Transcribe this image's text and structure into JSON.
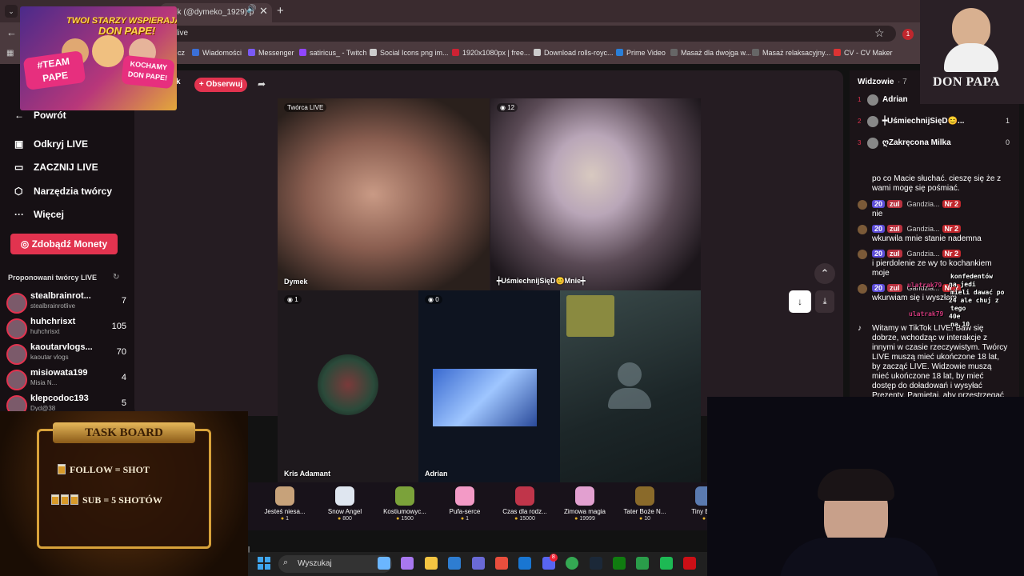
{
  "browser": {
    "tab_title": "ek (@dymeko_1929) p",
    "url": "live",
    "bookmarks": [
      {
        "label": "Wiadomości",
        "color": "#3b6fd6"
      },
      {
        "label": "Messenger",
        "color": "#7a5af5"
      },
      {
        "label": "satiricus_ - Twitch",
        "color": "#9146ff"
      },
      {
        "label": "Social Icons png im...",
        "color": "#cccccc"
      },
      {
        "label": "1920x1080px | free...",
        "color": "#c23"
      },
      {
        "label": "Download rolls-royc...",
        "color": "#cccccc"
      },
      {
        "label": "Prime Video",
        "color": "#2a7fd8"
      },
      {
        "label": "Masaż dla dwojga w...",
        "color": "#666666"
      },
      {
        "label": "Masaż relaksacyjny...",
        "color": "#666666"
      },
      {
        "label": "CV - CV Maker",
        "color": "#d33"
      }
    ],
    "bookmark_prefix": "cz",
    "ext_badge": "1"
  },
  "sidebar": {
    "back": "Powrót",
    "nav": [
      {
        "label": "Odkryj LIVE",
        "icon": "calendar-icon"
      },
      {
        "label": "ZACZNIJ LIVE",
        "icon": "camera-icon"
      },
      {
        "label": "Narzędzia twórcy",
        "icon": "shield-icon"
      },
      {
        "label": "Więcej",
        "icon": "more-icon"
      }
    ],
    "coins_button": "Zdobądź Monety",
    "suggested_title": "Proponowani twórcy LIVE",
    "creators": [
      {
        "name": "stealbrainrot...",
        "sub": "stealbrainrotlive",
        "count": "7"
      },
      {
        "name": "huhchrisxt",
        "sub": "huhchrisxt",
        "count": "105"
      },
      {
        "name": "kaoutarvlogs...",
        "sub": "kaoutar vlogs",
        "count": "70"
      },
      {
        "name": "misiowata199",
        "sub": "Misia N...",
        "count": "4"
      },
      {
        "name": "klepcodoc193",
        "sub": "Dyd@38",
        "count": "5"
      }
    ]
  },
  "stage": {
    "host_short": "k",
    "follow_button": "+ Obserwuj",
    "tiles": [
      {
        "label": "Dymek",
        "count": "Twórca LIVE"
      },
      {
        "label": "┿UśmiechnijSięD😊Mnie┿",
        "count": "12"
      },
      {
        "label": "Kris Adamant",
        "count": "1"
      },
      {
        "label": "Adrian",
        "count": "0"
      },
      {
        "label": "",
        "count": ""
      }
    ]
  },
  "viewers": {
    "title": "Widzowie",
    "count": "· 7",
    "list": [
      {
        "rank": "1",
        "name": "Adrian",
        "score": ""
      },
      {
        "rank": "2",
        "name": "┿UśmiechnijSięD😊...",
        "score": "1"
      },
      {
        "rank": "3",
        "name": "ღZakręcona Milka",
        "score": "0"
      }
    ]
  },
  "chat": {
    "messages": [
      {
        "meta": "",
        "text": "po co Macie słuchać. cieszę się że z wami mogę się pośmiać."
      },
      {
        "meta": {
          "lvl": "20",
          "tag": "zul",
          "name": "Gandzia...",
          "nr": "Nr 2"
        },
        "text": "nie"
      },
      {
        "meta": {
          "lvl": "20",
          "tag": "zul",
          "name": "Gandzia...",
          "nr": "Nr 2"
        },
        "text": "wkurwila mnie stanie nademna"
      },
      {
        "meta": {
          "lvl": "20",
          "tag": "zul",
          "name": "Gandzia...",
          "nr": "Nr 2"
        },
        "text": "i pierdolenie ze wy to kochankiem moje"
      },
      {
        "meta": {
          "lvl": "20",
          "tag": "zul",
          "name": "Gandzia...",
          "nr": "Nr 2"
        },
        "text": "wkurwiam się i wyszłam"
      }
    ],
    "system": "Witamy w TikTok LIVE! Baw się dobrze, wchodząc w interakcje z innymi w czasie rzeczywistym. Twórcy LIVE muszą mieć ukończone 18 lat, by zacząć LIVE. Widzowie muszą mieć ukończone 18 lat, by mieć dostęp do doładowań i wysyłać Prezenty. Pamiętaj, aby przestrzegać naszych",
    "overlay_lines": [
      "konfedentów",
      "na jedi",
      "mieli dawać po",
      "24 ale chuj z",
      "tego",
      "40e",
      "na 10"
    ],
    "overlay_names": [
      "ulatrak79",
      "ulatrak79"
    ]
  },
  "gifts": [
    {
      "name": "Jesteś niesa...",
      "price": "1",
      "color": "#c7a27a"
    },
    {
      "name": "Snow Angel",
      "price": "800",
      "color": "#dfe6f0"
    },
    {
      "name": "Kostiumowyc...",
      "price": "1500",
      "color": "#7ba23a"
    },
    {
      "name": "Pufa-serce",
      "price": "1",
      "color": "#f39ac6"
    },
    {
      "name": "Czas dla rodz...",
      "price": "15000",
      "color": "#c0354a"
    },
    {
      "name": "Zimowa magia",
      "price": "19999",
      "color": "#e2a0d0"
    },
    {
      "name": "Tater Boże N...",
      "price": "10",
      "color": "#8a6a2a"
    },
    {
      "name": "Tiny Bo...",
      "price": "",
      "color": "#5a7ab0"
    }
  ],
  "taskbar": {
    "search": "Wyszukaj",
    "discord_badge": "8",
    "icons": [
      "#6bb6ff",
      "#a878f0",
      "#f4c542",
      "#2e7dd1",
      "#6a6ad6",
      "#e94e3d",
      "#1976d2",
      "#5865f2",
      "#34a853",
      "#1b2838",
      "#107c10",
      "#2a9d4a",
      "#1db954",
      "#cc0f16"
    ]
  },
  "promo": {
    "line1": "TWOI STARZY WSPIERAJĄ",
    "line2": "DON PAPE!",
    "team": "#TEAM PAPE",
    "kocham": "KOCHAMY DON PAPE!"
  },
  "brand": {
    "name": "DON PAPA"
  },
  "taskboard": {
    "title": "TASK BOARD",
    "rules": [
      "FOLLOW = SHOT",
      "SUB = 5 SHOTÓW"
    ]
  }
}
